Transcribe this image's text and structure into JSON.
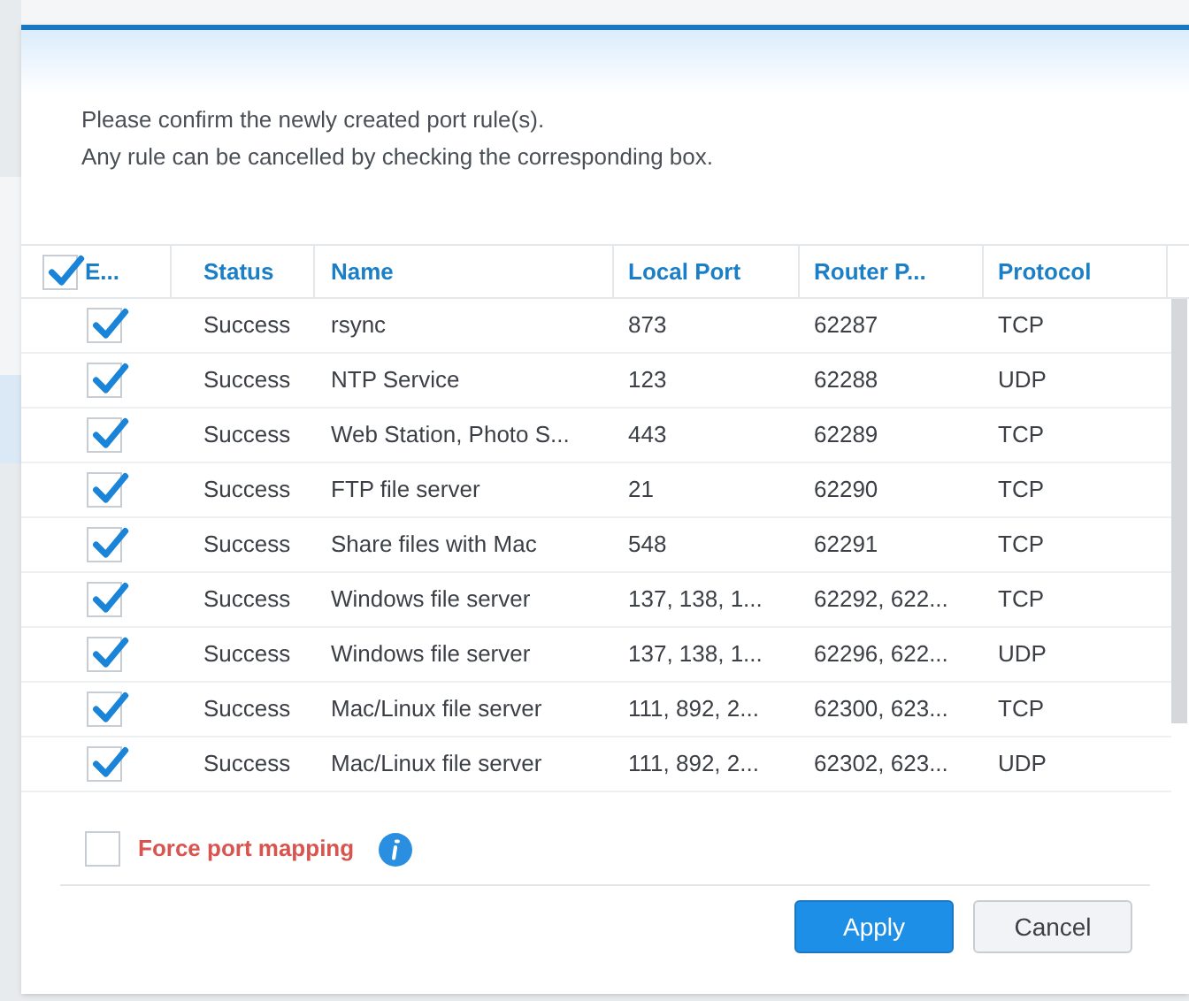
{
  "message": [
    "Please confirm the newly created port rule(s).",
    "Any rule can be cancelled by checking the corresponding box."
  ],
  "table": {
    "select_all": {
      "label": "E...",
      "checked": true
    },
    "columns": [
      "Status",
      "Name",
      "Local Port",
      "Router P...",
      "Protocol"
    ],
    "rows": [
      {
        "checked": true,
        "cells": [
          "Success",
          "rsync",
          "873",
          "62287",
          "TCP"
        ]
      },
      {
        "checked": true,
        "cells": [
          "Success",
          "NTP Service",
          "123",
          "62288",
          "UDP"
        ]
      },
      {
        "checked": true,
        "cells": [
          "Success",
          "Web Station, Photo S...",
          "443",
          "62289",
          "TCP"
        ]
      },
      {
        "checked": true,
        "cells": [
          "Success",
          "FTP file server",
          "21",
          "62290",
          "TCP"
        ]
      },
      {
        "checked": true,
        "cells": [
          "Success",
          "Share files with Mac",
          "548",
          "62291",
          "TCP"
        ]
      },
      {
        "checked": true,
        "cells": [
          "Success",
          "Windows file server",
          "137, 138, 1...",
          "62292, 622...",
          "TCP"
        ]
      },
      {
        "checked": true,
        "cells": [
          "Success",
          "Windows file server",
          "137, 138, 1...",
          "62296, 622...",
          "UDP"
        ]
      },
      {
        "checked": true,
        "cells": [
          "Success",
          "Mac/Linux file server",
          "111, 892, 2...",
          "62300, 623...",
          "TCP"
        ]
      },
      {
        "checked": true,
        "cells": [
          "Success",
          "Mac/Linux file server",
          "111, 892, 2...",
          "62302, 623...",
          "UDP"
        ]
      }
    ]
  },
  "force_port_mapping": {
    "label": "Force port mapping",
    "checked": false
  },
  "buttons": [
    {
      "kind": "primary",
      "label": "Apply"
    },
    {
      "kind": "secondary",
      "label": "Cancel"
    }
  ]
}
